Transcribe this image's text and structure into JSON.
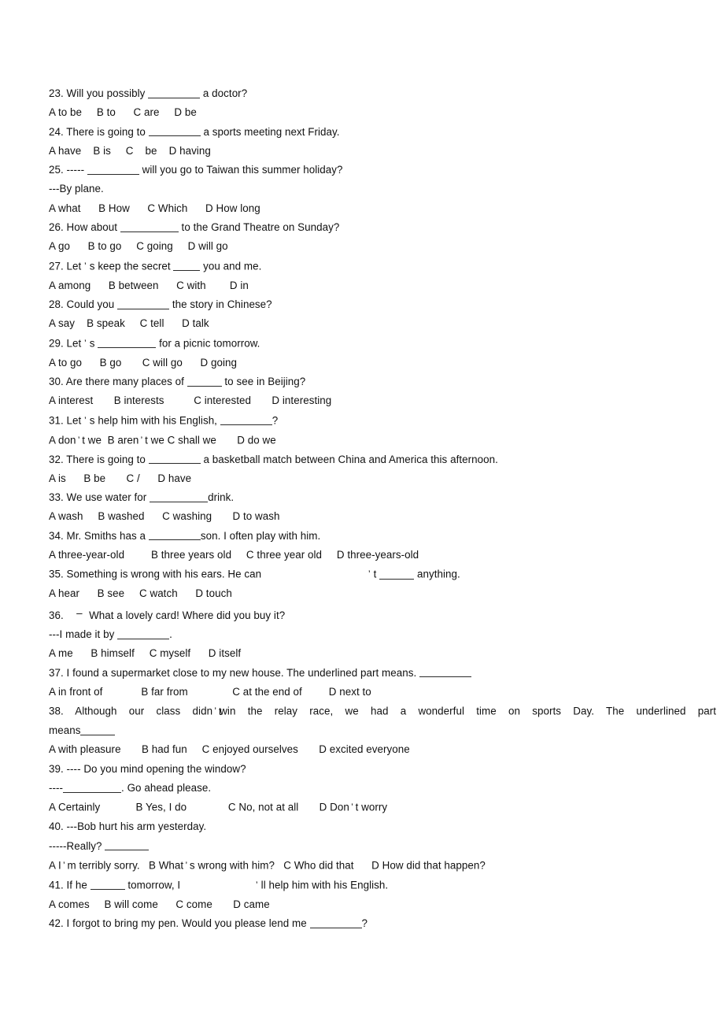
{
  "document": {
    "kind": "scanned-worksheet",
    "subject": "English grammar multiple choice",
    "page_background": "#ffffff",
    "text_color": "#111111",
    "question_range": "23-42"
  },
  "questions": [
    {
      "id": "q23",
      "number": "23.",
      "stem_before": "23. Will you possibly ",
      "stem_after": " a doctor?",
      "options_line": "A to be     B to      C are     D be"
    },
    {
      "id": "q24",
      "number": "24.",
      "stem_before": "24. There is going to ",
      "stem_after": " a sports meeting next Friday.",
      "options_line": "A have    B is     C    be    D having"
    },
    {
      "id": "q25",
      "number": "25.",
      "stem_before": "25. ----- ",
      "stem_after": " will you go to Taiwan this summer holiday?",
      "answer_line": "---By plane.",
      "options_line": "A what      B How      C Which      D How long"
    },
    {
      "id": "q26",
      "number": "26.",
      "stem_before": "26. How about ",
      "stem_after": " to the Grand Theatre on Sunday?",
      "options_line": "A go      B to go     C going     D will go"
    },
    {
      "id": "q27",
      "number": "27.",
      "stem_part1": "27. Let",
      "apostrophe": "’",
      "stem_part2": "s keep the secret ",
      "stem_after": " you and me.",
      "options_line": "A among      B between      C with        D in"
    },
    {
      "id": "q28",
      "number": "28.",
      "stem_before": "28. Could you ",
      "stem_after": " the story in Chinese?",
      "options_line": "A say    B speak     C tell      D talk"
    },
    {
      "id": "q29",
      "number": "29.",
      "stem_part1": "29. Let",
      "apostrophe": "’",
      "stem_part2": "s ",
      "stem_after": " for a picnic tomorrow.",
      "options_line": "A to go      B go       C will go      D going"
    },
    {
      "id": "q30",
      "number": "30.",
      "stem_before": "30. Are there many places of ",
      "stem_after": " to see in Beijing?",
      "options_line": "A interest       B interests          C interested       D interesting"
    },
    {
      "id": "q31",
      "number": "31.",
      "stem_part1": "31. Let",
      "apostrophe": "’",
      "stem_part2": "s help him with his English, ",
      "stem_after": "?",
      "options_part1": "A don",
      "options_apo1": "’",
      "options_part2": "t we  B aren",
      "options_apo2": "’",
      "options_part3": "t we C shall we       D do we"
    },
    {
      "id": "q32",
      "number": "32.",
      "stem_before": "32. There is going to ",
      "stem_after": " a basketball match between China and America this afternoon.",
      "options_line": "A is      B be       C /      D have"
    },
    {
      "id": "q33",
      "number": "33.",
      "stem_before": "33. We use water for ",
      "stem_after": "drink.",
      "options_line": "A wash     B washed      C washing       D to wash"
    },
    {
      "id": "q34",
      "number": "34.",
      "stem_before": "34. Mr. Smiths has a ",
      "stem_after": "son. I often play with him.",
      "options_line": "A three-year-old         B three years old     C three year old     D three-years-old"
    },
    {
      "id": "q35",
      "number": "35.",
      "stem_part1": "35. Something is wrong with his ears. He can",
      "apostrophe": "’",
      "stem_part2": "t ",
      "stem_after": " anything.",
      "options_line": "A hear      B see     C watch      D touch"
    },
    {
      "id": "q36",
      "number": "36.",
      "stem_part1": "36.",
      "dash": "–",
      "stem_part2": "What a lovely card! Where did you buy it?",
      "answer_before": "---I made it by ",
      "answer_after": ".",
      "options_line": "A me      B himself     C myself      D itself"
    },
    {
      "id": "q37",
      "number": "37.",
      "stem_before": "37. I found a supermarket close to my new house. The underlined part means. ",
      "stem_after": "",
      "options_line": "A in front of             B far from               C at the end of         D next to"
    },
    {
      "id": "q38",
      "number": "38.",
      "stem_words": "38. Although our class didn ’ t win the relay race, we had a wonderful time on sports Day. The underlined part",
      "stem_part1": "38. Although  our  class  didn",
      "apostrophe": "’",
      "stem_part2": "t",
      "stem_part3": "win  the  relay  race,  we  had  a  wonderful  time  on  sports  Day.  The  underlined  part",
      "continuation": "means",
      "options_line": "A with pleasure       B had fun     C enjoyed ourselves       D excited everyone"
    },
    {
      "id": "q39",
      "number": "39.",
      "stem_line": "39. ---- Do you mind opening the window?",
      "answer_before": "----",
      "answer_after": ". Go ahead please.",
      "options_part1": "A Certainly            B Yes, I do              C No, not at all       D Don",
      "options_apo": "’",
      "options_part2": "t worry"
    },
    {
      "id": "q40",
      "number": "40.",
      "stem_line": "40. ---Bob hurt his arm yesterday.",
      "answer_before": "-----Really? ",
      "options_part1": "A I",
      "options_apo1": "’",
      "options_part2": "m terribly sorry.   B What",
      "options_apo2": "’",
      "options_part3": "s wrong with him?   C Who did that      D How did that happen?"
    },
    {
      "id": "q41",
      "number": "41.",
      "stem_part1": "41. If he ",
      "stem_part2": " tomorrow, I",
      "apostrophe": "’",
      "stem_part3": "ll help him with his English.",
      "options_line": "A comes     B will come      C come       D came"
    },
    {
      "id": "q42",
      "number": "42.",
      "stem_before": "42. I forgot to bring my pen. Would you please lend me ",
      "stem_after": "?"
    }
  ]
}
